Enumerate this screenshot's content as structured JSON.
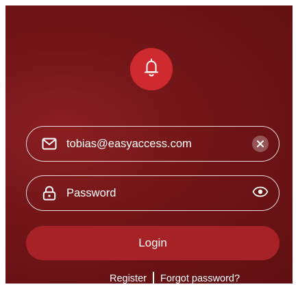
{
  "app": {
    "logo_icon": "bell-icon",
    "accent_color": "#cf2a30"
  },
  "email_field": {
    "value": "tobias@easyaccess.com",
    "leading_icon": "mail-icon",
    "trailing_icon": "clear-icon"
  },
  "password_field": {
    "placeholder": "Password",
    "leading_icon": "lock-icon",
    "trailing_icon": "eye-icon"
  },
  "login_button": {
    "label": "Login"
  },
  "links": {
    "register": "Register",
    "forgot_password": "Forgot password?"
  }
}
